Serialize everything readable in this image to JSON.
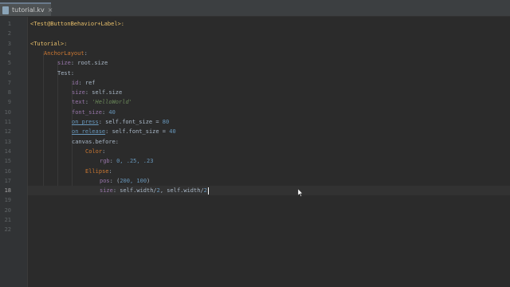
{
  "tab": {
    "filename": "tutorial.kv",
    "icon": "file-icon",
    "close": "×"
  },
  "line_numbers": [
    "1",
    "2",
    "3",
    "4",
    "5",
    "6",
    "7",
    "8",
    "9",
    "10",
    "11",
    "12",
    "13",
    "14",
    "15",
    "16",
    "17",
    "18",
    "19",
    "20",
    "21",
    "22"
  ],
  "current_line": 18,
  "code": {
    "l1_open": "<",
    "l1_name": "Test@ButtonBehavior+Label",
    "l1_close": ">:",
    "l3_open": "<",
    "l3_name": "Tutorial",
    "l3_close": ">:",
    "l4": "AnchorLayout",
    "l4_colon": ":",
    "l5_key": "size",
    "l5_rest": ": root.size",
    "l6": "Test:",
    "l7_key": "id",
    "l7_rest": ": ref",
    "l8_key": "size",
    "l8_rest": ": self.size",
    "l9_key": "text",
    "l9_colon": ": ",
    "l9_val": "'HelloWorld'",
    "l10_key": "font_size",
    "l10_colon": ": ",
    "l10_val": "40",
    "l11_key": "on_press",
    "l11_rest": ": self.font_size = ",
    "l11_val": "80",
    "l12_key": "on_release",
    "l12_rest": ": self.font_size = ",
    "l12_val": "40",
    "l13": "canvas.before:",
    "l14_key": "Color",
    "l14_colon": ":",
    "l15_key": "rgb",
    "l15_colon": ": ",
    "l15_val": "0, .25, .23",
    "l16_key": "Ellipse",
    "l16_colon": ":",
    "l17_key": "pos",
    "l17_colon": ": (",
    "l17_val": "200, 100",
    "l17_end": ")",
    "l18_key": "size",
    "l18_rest": ": self.width/",
    "l18_n1": "2",
    "l18_mid": ", self.width/",
    "l18_n2": "2"
  }
}
